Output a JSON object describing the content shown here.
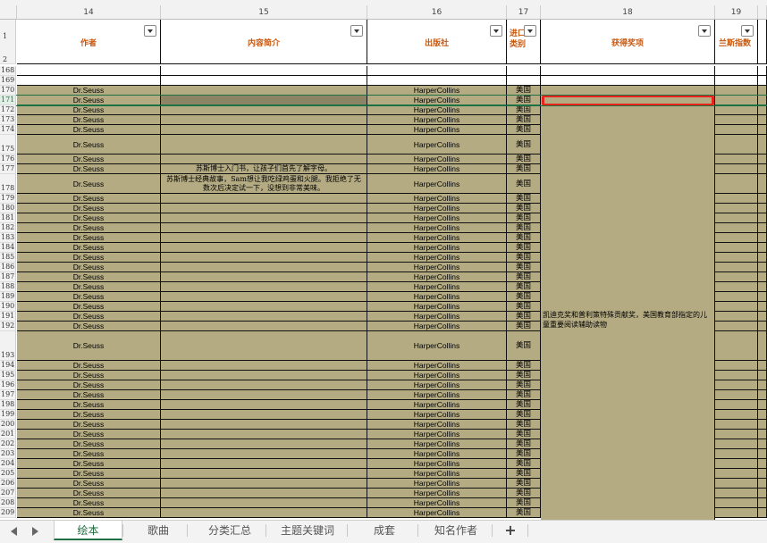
{
  "column_headers": [
    "14",
    "15",
    "16",
    "17",
    "18",
    "19"
  ],
  "header_row_numbers": [
    "1",
    "2"
  ],
  "header_labels": {
    "author": "作者",
    "summary": "内容简介",
    "publisher": "出版社",
    "country": "进口类别",
    "award": "获得奖项",
    "lexile": "兰斯指数"
  },
  "rows": [
    {
      "n": "168",
      "a": "",
      "p": "",
      "c": "",
      "blank": true
    },
    {
      "n": "169",
      "a": "",
      "p": "",
      "c": "",
      "blank": true
    },
    {
      "n": "170",
      "a": "Dr.Seuss",
      "p": "HarperCollins",
      "c": "美国"
    },
    {
      "n": "171",
      "a": "Dr.Seuss",
      "p": "HarperCollins",
      "c": "美国",
      "selected": true
    },
    {
      "n": "172",
      "a": "Dr.Seuss",
      "p": "HarperCollins",
      "c": "美国"
    },
    {
      "n": "173",
      "a": "Dr.Seuss",
      "p": "HarperCollins",
      "c": "美国"
    },
    {
      "n": "174",
      "a": "Dr.Seuss",
      "p": "HarperCollins",
      "c": "美国"
    },
    {
      "n": "175",
      "a": "Dr.Seuss",
      "p": "HarperCollins",
      "c": "美国",
      "tall": 2
    },
    {
      "n": "176",
      "a": "Dr.Seuss",
      "p": "HarperCollins",
      "c": "美国"
    },
    {
      "n": "177",
      "a": "Dr.Seuss",
      "p": "HarperCollins",
      "c": "美国",
      "s": "苏斯博士入门书，让孩子们首先了解字母。"
    },
    {
      "n": "178",
      "a": "Dr.Seuss",
      "p": "HarperCollins",
      "c": "美国",
      "tall": 2,
      "s": "苏斯博士经典故事，Sam想让我吃绿鸡蛋和火腿。我拒绝了无数次后决定试一下，没想到非常美味。"
    },
    {
      "n": "179",
      "a": "Dr.Seuss",
      "p": "HarperCollins",
      "c": "美国"
    },
    {
      "n": "180",
      "a": "Dr.Seuss",
      "p": "HarperCollins",
      "c": "美国"
    },
    {
      "n": "181",
      "a": "Dr.Seuss",
      "p": "HarperCollins",
      "c": "美国"
    },
    {
      "n": "182",
      "a": "Dr.Seuss",
      "p": "HarperCollins",
      "c": "美国"
    },
    {
      "n": "183",
      "a": "Dr.Seuss",
      "p": "HarperCollins",
      "c": "美国"
    },
    {
      "n": "184",
      "a": "Dr.Seuss",
      "p": "HarperCollins",
      "c": "美国"
    },
    {
      "n": "185",
      "a": "Dr.Seuss",
      "p": "HarperCollins",
      "c": "美国"
    },
    {
      "n": "186",
      "a": "Dr.Seuss",
      "p": "HarperCollins",
      "c": "美国"
    },
    {
      "n": "187",
      "a": "Dr.Seuss",
      "p": "HarperCollins",
      "c": "美国"
    },
    {
      "n": "188",
      "a": "Dr.Seuss",
      "p": "HarperCollins",
      "c": "美国"
    },
    {
      "n": "189",
      "a": "Dr.Seuss",
      "p": "HarperCollins",
      "c": "美国"
    },
    {
      "n": "190",
      "a": "Dr.Seuss",
      "p": "HarperCollins",
      "c": "美国"
    },
    {
      "n": "191",
      "a": "Dr.Seuss",
      "p": "HarperCollins",
      "c": "美国"
    },
    {
      "n": "192",
      "a": "Dr.Seuss",
      "p": "HarperCollins",
      "c": "美国"
    },
    {
      "n": "193",
      "a": "Dr.Seuss",
      "p": "HarperCollins",
      "c": "美国",
      "tall": 3
    },
    {
      "n": "194",
      "a": "Dr.Seuss",
      "p": "HarperCollins",
      "c": "美国"
    },
    {
      "n": "195",
      "a": "Dr.Seuss",
      "p": "HarperCollins",
      "c": "美国"
    },
    {
      "n": "196",
      "a": "Dr.Seuss",
      "p": "HarperCollins",
      "c": "美国"
    },
    {
      "n": "197",
      "a": "Dr.Seuss",
      "p": "HarperCollins",
      "c": "美国"
    },
    {
      "n": "198",
      "a": "Dr.Seuss",
      "p": "HarperCollins",
      "c": "美国"
    },
    {
      "n": "199",
      "a": "Dr.Seuss",
      "p": "HarperCollins",
      "c": "美国"
    },
    {
      "n": "200",
      "a": "Dr.Seuss",
      "p": "HarperCollins",
      "c": "美国"
    },
    {
      "n": "201",
      "a": "Dr.Seuss",
      "p": "HarperCollins",
      "c": "美国"
    },
    {
      "n": "202",
      "a": "Dr.Seuss",
      "p": "HarperCollins",
      "c": "美国"
    },
    {
      "n": "203",
      "a": "Dr.Seuss",
      "p": "HarperCollins",
      "c": "美国"
    },
    {
      "n": "204",
      "a": "Dr.Seuss",
      "p": "HarperCollins",
      "c": "美国"
    },
    {
      "n": "205",
      "a": "Dr.Seuss",
      "p": "HarperCollins",
      "c": "美国"
    },
    {
      "n": "206",
      "a": "Dr.Seuss",
      "p": "HarperCollins",
      "c": "美国"
    },
    {
      "n": "207",
      "a": "Dr.Seuss",
      "p": "HarperCollins",
      "c": "美国"
    },
    {
      "n": "208",
      "a": "Dr.Seuss",
      "p": "HarperCollins",
      "c": "美国"
    },
    {
      "n": "209",
      "a": "Dr.Seuss",
      "p": "HarperCollins",
      "c": "美国"
    }
  ],
  "merged_award_text": "凯迪克奖和普利策特殊贡献奖，美国教育部指定的儿童重要阅读辅助读物",
  "tabs": [
    "绘本",
    "歌曲",
    "分类汇总",
    "主题关键词",
    "成套",
    "知名作者"
  ],
  "active_tab": "绘本",
  "add_sheet_label": "+",
  "colors": {
    "fill": "#b4ab83",
    "header_text": "#c65911",
    "highlight": "#e8231a",
    "active_tab": "#1e7145"
  }
}
